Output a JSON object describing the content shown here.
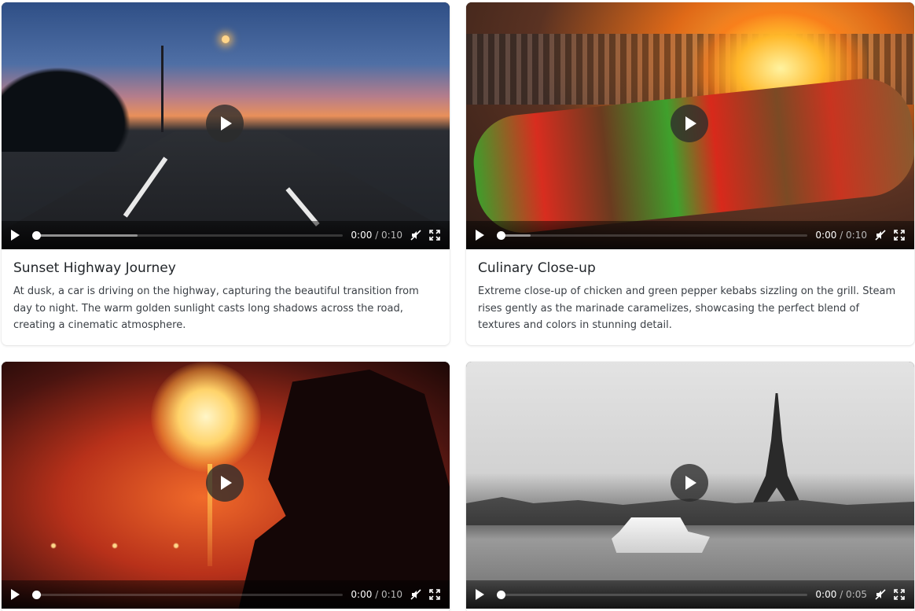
{
  "videos": [
    {
      "title": "Sunset Highway Journey",
      "description": "At dusk, a car is driving on the highway, capturing the beautiful transition from day to night. The warm golden sunlight casts long shadows across the road, creating a cinematic atmosphere.",
      "current_time": "0:00",
      "duration": "/ 0:10",
      "buffered_fraction": 0.34
    },
    {
      "title": "Culinary Close-up",
      "description": "Extreme close-up of chicken and green pepper kebabs sizzling on the grill. Steam rises gently as the marinade caramelizes, showcasing the perfect blend of textures and colors in stunning detail.",
      "current_time": "0:00",
      "duration": "/ 0:10",
      "buffered_fraction": 0.11
    },
    {
      "title": "",
      "description": "",
      "current_time": "0:00",
      "duration": "/ 0:10",
      "buffered_fraction": 0.0
    },
    {
      "title": "",
      "description": "",
      "current_time": "0:00",
      "duration": "/ 0:05",
      "buffered_fraction": 0.0
    }
  ],
  "icons": {
    "play": "play-icon",
    "mute": "muted-speaker-icon",
    "fullscreen": "fullscreen-icon"
  },
  "colors": {
    "card_bg": "#ffffff",
    "controls_bg": "#000000",
    "text": "#212529"
  }
}
